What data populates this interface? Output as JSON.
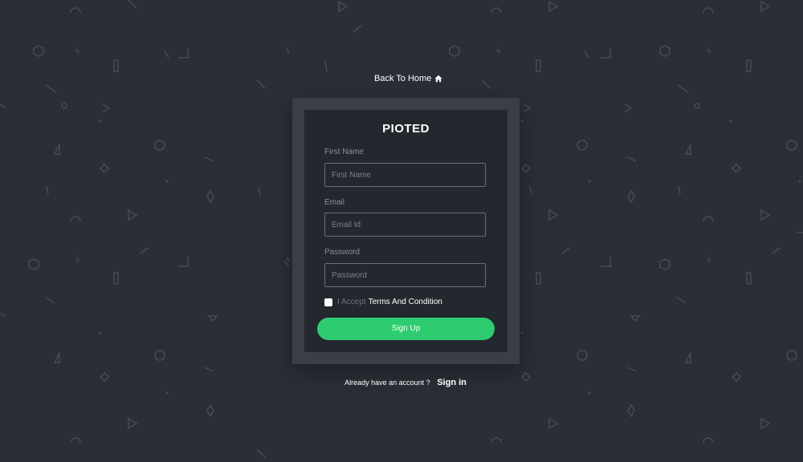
{
  "header": {
    "back_home_label": "Back To Home",
    "home_icon": "home-icon"
  },
  "card": {
    "logo_text": "PIOTED",
    "first_name": {
      "label": "First Name",
      "placeholder": "First Name"
    },
    "email": {
      "label": "Email",
      "placeholder": "Email Id"
    },
    "password": {
      "label": "Password",
      "placeholder": "Password"
    },
    "accept": {
      "prefix": "I Accept",
      "link": "Terms And Condition",
      "checked": false
    },
    "signup_label": "Sign Up"
  },
  "footer": {
    "question": "Already have an account ?",
    "signin_label": "Sign in"
  },
  "colors": {
    "background": "#2b2e36",
    "frame": "#3b3e47",
    "card": "#23272e",
    "accent": "#2ecc71",
    "pattern": "#4a4e57"
  }
}
